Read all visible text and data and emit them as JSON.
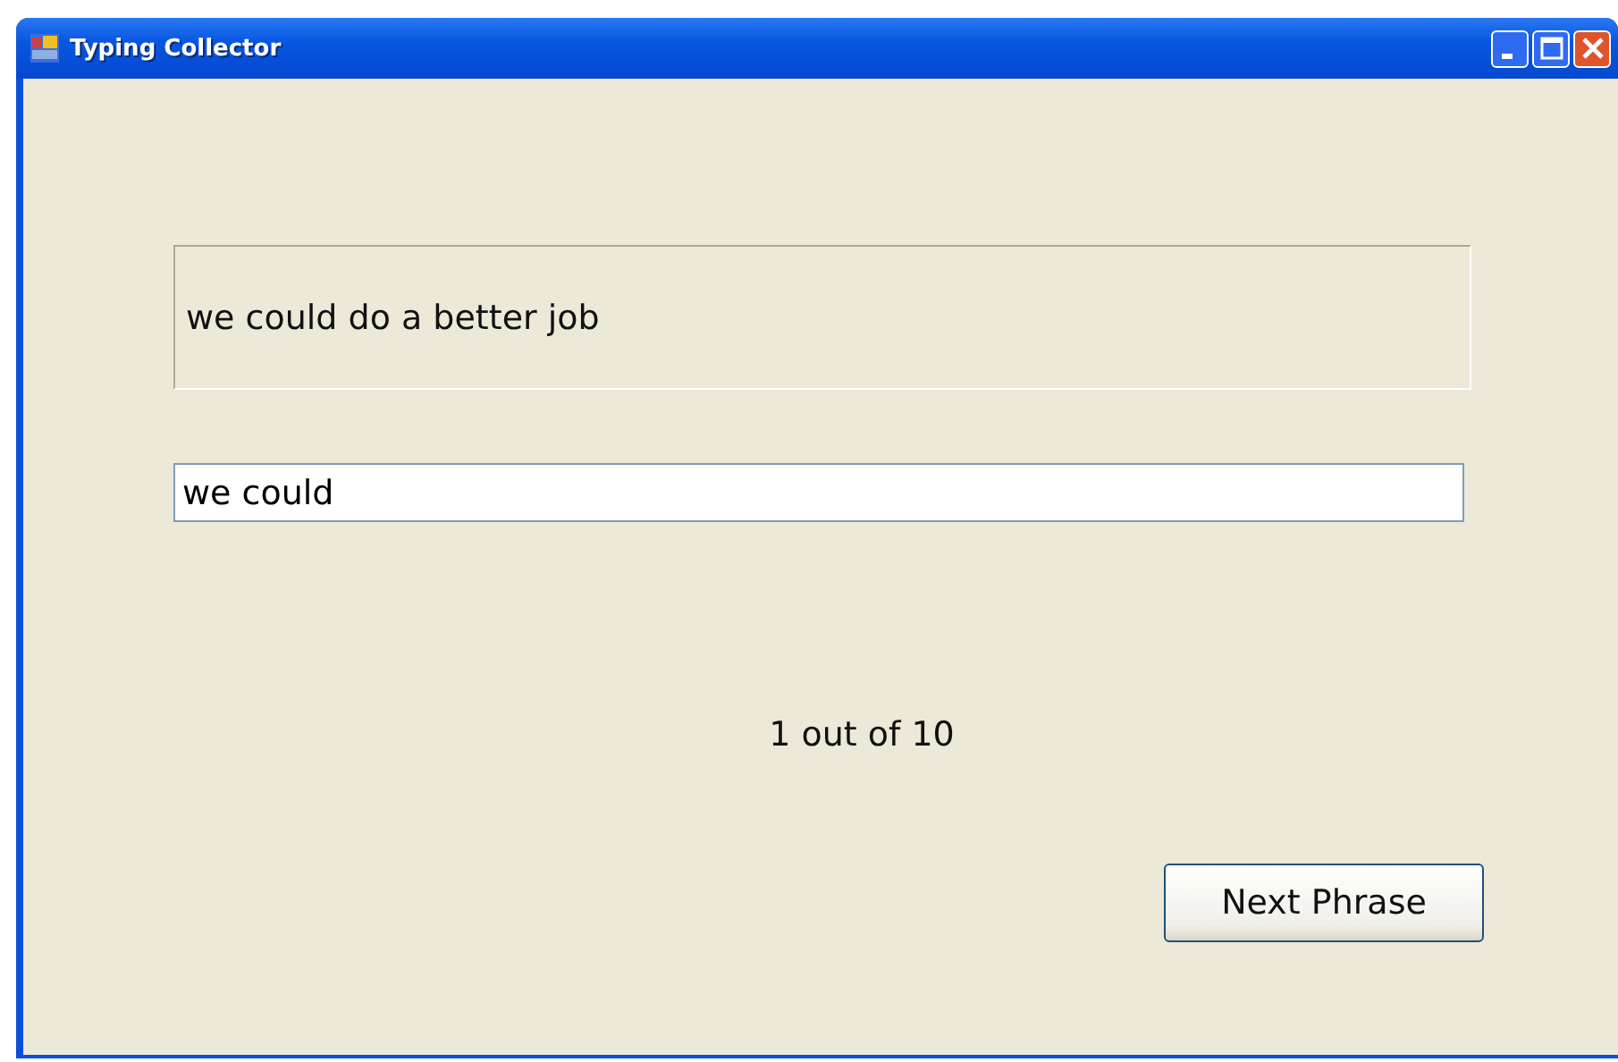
{
  "window": {
    "title": "Typing Collector"
  },
  "phrase": "we could do a better job",
  "input": {
    "value": "we could"
  },
  "progress": "1 out of 10",
  "buttons": [
    "Next Phrase"
  ]
}
